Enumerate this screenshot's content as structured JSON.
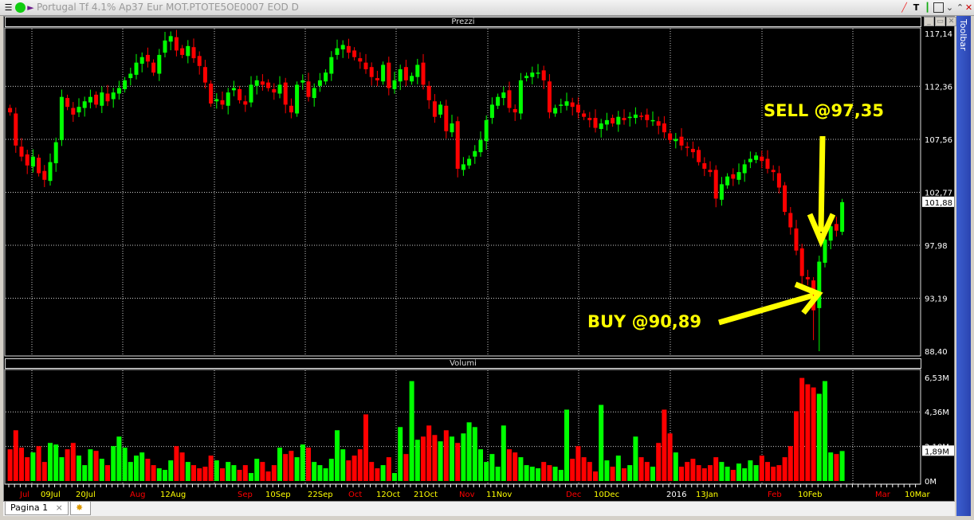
{
  "window": {
    "title": "Portugal Tf 4.1% Ap37 Eur MOT.PTOTE5OE0007 EOD D",
    "toolbar_label": "Toolbar",
    "tab": "Pagina 1",
    "tab_close": "×"
  },
  "panels": {
    "price_title": "Prezzi",
    "volume_title": "Volumi"
  },
  "colors": {
    "up": "#00ff00",
    "down": "#ff0000",
    "annotation": "#ffff00",
    "background": "#000000"
  },
  "annotations": {
    "sell": "SELL @97,35",
    "buy": "BUY @90,89"
  },
  "chart_data": [
    {
      "type": "candlestick",
      "title": "Prezzi",
      "y_ticks": [
        "117,14",
        "112,36",
        "107,56",
        "102,77",
        "97,98",
        "93,19",
        "88,40"
      ],
      "ylim": [
        88.4,
        117.14
      ],
      "last_value_label": "101,88",
      "x_labels": [
        {
          "t": "Jul",
          "k": "month"
        },
        {
          "t": "09Jul",
          "k": "day"
        },
        {
          "t": "20Jul",
          "k": "day"
        },
        {
          "t": "Aug",
          "k": "month"
        },
        {
          "t": "12Aug",
          "k": "day"
        },
        {
          "t": "Sep",
          "k": "month"
        },
        {
          "t": "10Sep",
          "k": "day"
        },
        {
          "t": "22Sep",
          "k": "day"
        },
        {
          "t": "Oct",
          "k": "month"
        },
        {
          "t": "12Oct",
          "k": "day"
        },
        {
          "t": "21Oct",
          "k": "day"
        },
        {
          "t": "Nov",
          "k": "month"
        },
        {
          "t": "11Nov",
          "k": "day"
        },
        {
          "t": "Dec",
          "k": "month"
        },
        {
          "t": "10Dec",
          "k": "day"
        },
        {
          "t": "2016",
          "k": "year"
        },
        {
          "t": "13Jan",
          "k": "day"
        },
        {
          "t": "Feb",
          "k": "month"
        },
        {
          "t": "10Feb",
          "k": "day"
        },
        {
          "t": "Mar",
          "k": "month"
        },
        {
          "t": "10Mar",
          "k": "day"
        }
      ],
      "close": [
        110.0,
        107.0,
        106.0,
        105.2,
        106.0,
        104.5,
        103.9,
        105.5,
        107.3,
        111.4,
        110.5,
        109.8,
        110.5,
        111.0,
        111.4,
        110.7,
        111.8,
        111.0,
        111.8,
        112.2,
        112.9,
        113.5,
        114.5,
        115.0,
        114.6,
        113.6,
        115.2,
        116.5,
        116.9,
        115.6,
        115.2,
        116.0,
        114.9,
        114.2,
        112.7,
        110.8,
        111.2,
        110.7,
        111.8,
        112.2,
        111.1,
        110.7,
        112.5,
        112.9,
        112.5,
        112.2,
        111.8,
        112.5,
        110.7,
        110.0,
        112.5,
        112.9,
        111.4,
        112.2,
        112.9,
        113.6,
        115.0,
        115.8,
        116.1,
        115.4,
        115.0,
        114.6,
        113.9,
        113.2,
        112.9,
        114.3,
        112.2,
        112.9,
        113.9,
        112.9,
        113.3,
        114.3,
        112.5,
        111.1,
        109.6,
        110.7,
        108.3,
        109.0,
        104.9,
        105.3,
        105.8,
        106.5,
        107.5,
        109.3,
        110.7,
        111.4,
        111.8,
        110.4,
        110.0,
        112.9,
        113.3,
        113.6,
        113.6,
        112.9,
        110.0,
        110.4,
        110.7,
        111.0,
        110.5,
        110.0,
        109.6,
        109.3,
        108.6,
        109.0,
        109.3,
        109.0,
        109.6,
        109.3,
        109.6,
        109.8,
        109.6,
        109.3,
        109.3,
        108.8,
        108.2,
        107.5,
        107.6,
        107.0,
        106.8,
        106.4,
        105.5,
        104.9,
        104.6,
        102.2,
        103.5,
        104.2,
        104.0,
        104.6,
        105.3,
        105.8,
        106.1,
        105.6,
        104.9,
        104.6,
        103.2,
        101.0,
        99.6,
        97.5,
        95.2,
        94.9,
        92.1,
        96.5,
        98.5,
        99.7,
        99.3,
        101.88
      ]
    },
    {
      "type": "bar",
      "title": "Volumi",
      "y_ticks": [
        "6,53M",
        "4,36M",
        "2,18M",
        "0M"
      ],
      "ylim": [
        0,
        6.53
      ],
      "last_value_label": "1,89M",
      "values": [
        2.0,
        3.2,
        2.1,
        1.5,
        1.8,
        2.2,
        1.2,
        2.4,
        2.3,
        1.5,
        2.0,
        2.4,
        1.6,
        1.0,
        2.0,
        1.9,
        1.4,
        1.0,
        2.2,
        2.8,
        2.1,
        1.2,
        1.6,
        1.8,
        1.4,
        1.0,
        0.8,
        0.7,
        1.3,
        2.2,
        1.8,
        1.2,
        1.0,
        0.8,
        0.9,
        1.6,
        1.3,
        0.8,
        1.2,
        1.0,
        0.7,
        1.0,
        0.5,
        1.4,
        1.2,
        0.6,
        1.0,
        2.1,
        1.7,
        1.9,
        1.5,
        2.3,
        2.1,
        1.2,
        1.0,
        0.8,
        1.4,
        3.2,
        2.0,
        1.3,
        1.6,
        2.0,
        4.2,
        1.2,
        0.8,
        1.0,
        1.5,
        0.5,
        3.4,
        1.7,
        6.3,
        2.6,
        2.8,
        3.5,
        2.9,
        2.5,
        3.2,
        2.8,
        2.4,
        3.0,
        3.7,
        3.4,
        2.0,
        1.2,
        1.7,
        0.9,
        3.5,
        2.0,
        1.8,
        1.5,
        1.0,
        0.9,
        0.8,
        1.2,
        1.0,
        0.9,
        0.7,
        4.5,
        1.4,
        2.2,
        1.5,
        1.2,
        0.6,
        4.8,
        1.3,
        0.9,
        1.6,
        0.8,
        1.0,
        2.8,
        1.5,
        1.2,
        0.9,
        2.4,
        4.5,
        3.0,
        1.8,
        0.9,
        1.2,
        1.4,
        1.0,
        0.8,
        1.0,
        1.5,
        1.2,
        0.9,
        0.7,
        1.1,
        0.8,
        1.3,
        1.0,
        1.6,
        1.2,
        0.9,
        1.0,
        1.5,
        2.2,
        4.4,
        6.5,
        6.1,
        5.9,
        5.5,
        6.3,
        1.8,
        1.7,
        1.89
      ]
    }
  ]
}
